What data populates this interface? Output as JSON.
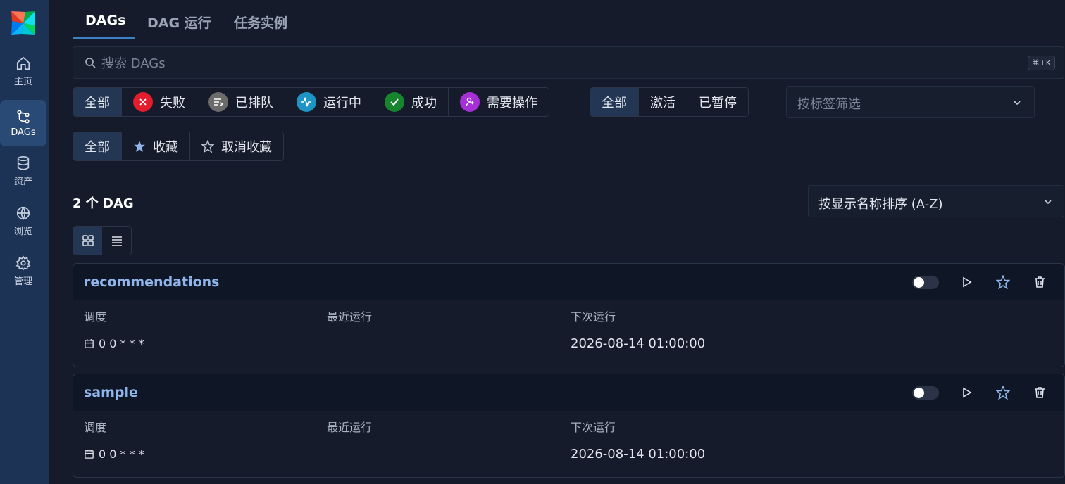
{
  "sidebar": {
    "items": [
      {
        "label": "主页",
        "icon": "home-icon"
      },
      {
        "label": "DAGs",
        "icon": "dags-icon"
      },
      {
        "label": "资产",
        "icon": "database-icon"
      },
      {
        "label": "浏览",
        "icon": "globe-icon"
      },
      {
        "label": "管理",
        "icon": "gear-icon"
      }
    ],
    "active": "DAGs"
  },
  "tabs": [
    {
      "label": "DAGs",
      "active": true
    },
    {
      "label": "DAG 运行",
      "active": false
    },
    {
      "label": "任务实例",
      "active": false
    }
  ],
  "search": {
    "placeholder": "搜索 DAGs",
    "shortcut": "⌘+K"
  },
  "state_filter": {
    "items": [
      {
        "label": "全部",
        "active": true
      },
      {
        "label": "失败",
        "color": "#e11d2e",
        "icon": "x-icon"
      },
      {
        "label": "已排队",
        "color": "#6b6b6b",
        "icon": "queue-icon"
      },
      {
        "label": "运行中",
        "color": "#1d93c6",
        "icon": "activity-icon"
      },
      {
        "label": "成功",
        "color": "#16852d",
        "icon": "check-icon"
      },
      {
        "label": "需要操作",
        "color": "#a62fd6",
        "icon": "hand-icon"
      }
    ]
  },
  "active_filter": {
    "items": [
      {
        "label": "全部",
        "active": true
      },
      {
        "label": "激活"
      },
      {
        "label": "已暂停"
      }
    ]
  },
  "tag_filter": {
    "placeholder": "按标签筛选"
  },
  "favorite_filter": {
    "items": [
      {
        "label": "全部",
        "active": true
      },
      {
        "label": "收藏"
      },
      {
        "label": "取消收藏"
      }
    ]
  },
  "dag_count": "2 个 DAG",
  "sort": {
    "value": "按显示名称排序 (A-Z)"
  },
  "columns": {
    "schedule": "调度",
    "latest_run": "最近运行",
    "next_run": "下次运行"
  },
  "dags": [
    {
      "name": "recommendations",
      "schedule": "0 0 * * *",
      "latest_run": "",
      "next_run": "2026-08-14 01:00:00",
      "paused": true
    },
    {
      "name": "sample",
      "schedule": "0 0 * * *",
      "latest_run": "",
      "next_run": "2026-08-14 01:00:00",
      "paused": true
    }
  ],
  "colors": {
    "accent": "#3b82c4",
    "sidebar": "#1c3355",
    "background": "#151b2b",
    "dag_link": "#8fb5ea"
  }
}
